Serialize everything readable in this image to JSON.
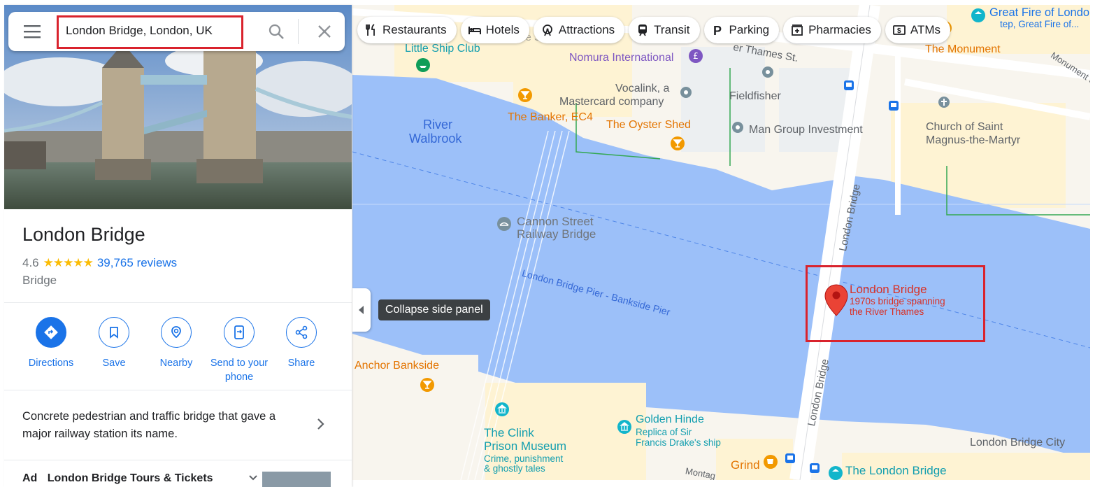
{
  "search": {
    "value": "London Bridge, London, UK"
  },
  "place": {
    "name": "London Bridge",
    "rating": "4.6",
    "stars": "★★★★★",
    "reviews": "39,765 reviews",
    "category": "Bridge",
    "description": "Concrete pedestrian and traffic bridge that gave a major railway station its name."
  },
  "actions": {
    "directions": "Directions",
    "save": "Save",
    "nearby": "Nearby",
    "send_line1": "Send to your",
    "send_line2": "phone",
    "share": "Share"
  },
  "ad": {
    "label": "Ad",
    "text": "London Bridge Tours & Tickets"
  },
  "collapse": {
    "tooltip": "Collapse side panel"
  },
  "chips": {
    "restaurants": "Restaurants",
    "hotels": "Hotels",
    "attractions": "Attractions",
    "transit": "Transit",
    "parking": "Parking",
    "pharmacies": "Pharmacies",
    "atms": "ATMs"
  },
  "map": {
    "great_fire": "Great Fire of Londo",
    "great_fire_sub": "tep, Great Fire of...",
    "the_monument": "The Monument",
    "monument_st": "Monument St",
    "little_ship_club": "Little Ship Club",
    "thames_st": "er Thames St.",
    "steelyard": "The Steelyard Hig",
    "nomura": "Nomura International",
    "vocalink_1": "Vocalink, a",
    "vocalink_2": "Mastercard company",
    "fieldfisher": "Fieldfisher",
    "banker": "The Banker, EC4",
    "oyster_shed": "The Oyster Shed",
    "man_group": "Man Group Investment",
    "church_1": "Church of Saint",
    "church_2": "Magnus-the-Martyr",
    "river_walbrook_1": "River",
    "river_walbrook_2": "Walbrook",
    "cannon_1": "Cannon Street",
    "cannon_2": "Railway Bridge",
    "pier": "London Bridge Pier - Bankside Pier",
    "london_bridge_road": "London Bridge",
    "pin_title": "London Bridge",
    "pin_sub1": "1970s bridge spanning",
    "pin_sub2": "the River Thames",
    "anchor": "Anchor Bankside",
    "golden_hinde": "Golden Hinde",
    "golden_sub1": "Replica of Sir",
    "golden_sub2": "Francis Drake's ship",
    "clink_1": "The Clink",
    "clink_2": "Prison Museum",
    "clink_sub1": "Crime, punishment",
    "clink_sub2": "& ghostly tales",
    "lb_city": "London Bridge City",
    "grind": "Grind",
    "the_london_bridge": "The London Bridge",
    "montague": "Montag"
  },
  "colors": {
    "water": "#9cc0f9",
    "accent": "#1a73e8",
    "highlight_box": "#d9232d"
  }
}
